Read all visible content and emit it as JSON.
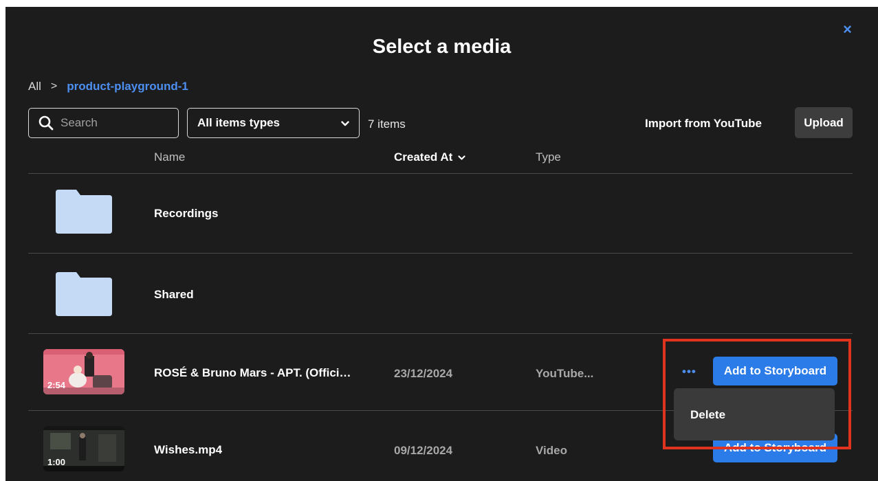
{
  "modal": {
    "title": "Select a media",
    "close_icon": "×"
  },
  "breadcrumb": {
    "root": "All",
    "separator": ">",
    "current": "product-playground-1"
  },
  "toolbar": {
    "search_placeholder": "Search",
    "type_filter": "All items types",
    "item_count": "7 items",
    "import_label": "Import from YouTube",
    "upload_label": "Upload"
  },
  "table": {
    "headers": {
      "name": "Name",
      "created_at": "Created At",
      "type": "Type"
    },
    "rows": [
      {
        "name": "Recordings",
        "kind": "folder"
      },
      {
        "name": "Shared",
        "kind": "folder"
      },
      {
        "name": "ROSÉ & Bruno Mars - APT. (Offici…",
        "created": "23/12/2024",
        "type": "YouTube...",
        "duration": "2:54",
        "action": "Add to Storyboard",
        "more": "•••"
      },
      {
        "name": "Wishes.mp4",
        "created": "09/12/2024",
        "type": "Video",
        "duration": "1:00",
        "action": "Add to Storyboard"
      }
    ]
  },
  "context_menu": {
    "items": [
      "Delete"
    ]
  },
  "colors": {
    "background": "#1c1c1d",
    "accent": "#2b7ce9",
    "link": "#4d8ff0",
    "folder": "#c5dbf5",
    "highlight": "#e0341f"
  }
}
